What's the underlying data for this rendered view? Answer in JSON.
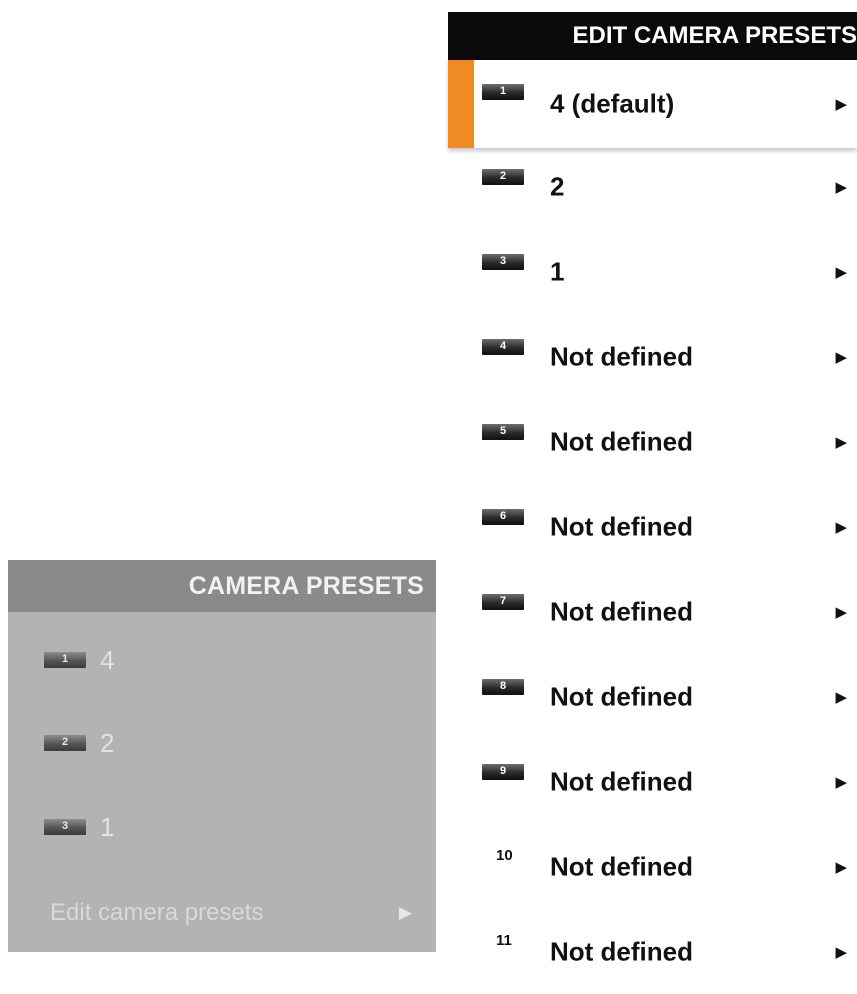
{
  "camera_presets_panel": {
    "title": "CAMERA PRESETS",
    "items": [
      {
        "number": "1",
        "label": "4"
      },
      {
        "number": "2",
        "label": "2"
      },
      {
        "number": "3",
        "label": "1"
      }
    ],
    "edit_label": "Edit camera presets",
    "edit_arrow": "▶"
  },
  "edit_panel": {
    "title": "EDIT CAMERA PRESETS",
    "accent_color": "#f28a24",
    "items": [
      {
        "number": "1",
        "label": "4 (default)",
        "arrow": "▶"
      },
      {
        "number": "2",
        "label": "2",
        "arrow": "▶"
      },
      {
        "number": "3",
        "label": "1",
        "arrow": "▶"
      },
      {
        "number": "4",
        "label": "Not defined",
        "arrow": "▶"
      },
      {
        "number": "5",
        "label": "Not defined",
        "arrow": "▶"
      },
      {
        "number": "6",
        "label": "Not defined",
        "arrow": "▶"
      },
      {
        "number": "7",
        "label": "Not defined",
        "arrow": "▶"
      },
      {
        "number": "8",
        "label": "Not defined",
        "arrow": "▶"
      },
      {
        "number": "9",
        "label": "Not defined",
        "arrow": "▶"
      },
      {
        "number": "10",
        "label": "Not defined",
        "arrow": "▶"
      },
      {
        "number": "11",
        "label": "Not defined",
        "arrow": "▶"
      }
    ]
  }
}
